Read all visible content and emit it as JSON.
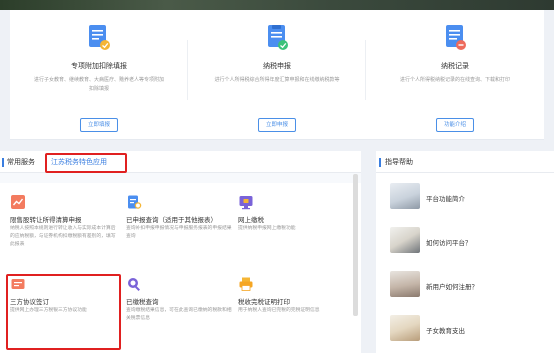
{
  "services": [
    {
      "title": "专项附加扣除填报",
      "desc": "进行子女教育、继续教育、大病医疗、赡养老人等专项附加扣除填报",
      "button": "立即填报",
      "icon": "form-doc-icon"
    },
    {
      "title": "纳税申报",
      "desc": "进行个人所得税综合所得年度汇算申报和在线缴纳税款等",
      "button": "立即申报",
      "icon": "tax-return-icon"
    },
    {
      "title": "纳税记录",
      "desc": "进行个人所得税纳税记录的在线查询、下载和打印",
      "button": "功能介绍",
      "icon": "tax-record-icon"
    }
  ],
  "tabs": {
    "common": "常用服务",
    "jiangsu": "江苏税务特色应用"
  },
  "tiles": [
    {
      "title": "限售股转让所得清算申报",
      "desc": "纳税人按照本规则进行转让收入与实际成本计算后的应纳税额，与证券机构扣缴税额有差别的，填写此报表",
      "icon": "stock-chart-icon"
    },
    {
      "title": "已申报查询（适用于其他报表）",
      "desc": "查询补扣申报申报情况与申报服务报表的申报结果查询",
      "icon": "clipboard-search-icon"
    },
    {
      "title": "网上缴税",
      "desc": "提供纳税申报网上缴税功能",
      "icon": "online-pay-icon"
    },
    {
      "title": "三方协议签订",
      "desc": "提供网上办理三方税银三方协议功能",
      "icon": "agreement-icon"
    },
    {
      "title": "已缴税查询",
      "desc": "查询缴税结果信息，可在此查询已缴纳的税款和相关税票信息",
      "icon": "paid-search-icon"
    },
    {
      "title": "税收完税证明打印",
      "desc": "用于纳税人查询已完税的完税证明信息",
      "icon": "printer-icon"
    }
  ],
  "help": {
    "title": "指导帮助",
    "items": [
      "平台功能简介",
      "如何访问平台？",
      "新用户如何注册？",
      "子女教育支出"
    ]
  },
  "colors": {
    "accent": "#3a7ee0",
    "highlight": "#e02020"
  }
}
